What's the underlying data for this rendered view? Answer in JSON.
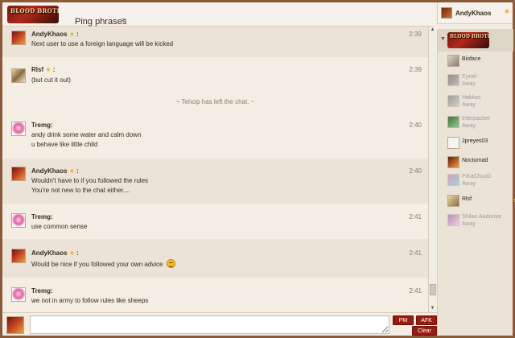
{
  "header": {
    "logo_text": "BLOOD BROTHERS",
    "room_title": "Ping phrases",
    "room_help": "(?)"
  },
  "me": {
    "name": "AndyKhaos"
  },
  "messages": [
    {
      "user": "AndyKhaos",
      "star": "★",
      "colon": ":",
      "lines": [
        "Next user to use a foreign language will be kicked"
      ],
      "time": "2:39"
    },
    {
      "user": "Rlsf",
      "star": "★",
      "colon": ":",
      "lines": [
        "(but cut it out)"
      ],
      "time": "2:39"
    },
    {
      "inline": "~ Tehcip has left the chat. ~"
    },
    {
      "user": "Tremg:",
      "lines": [
        "andy drink some water and calm down",
        "u behave like little child"
      ],
      "time": "2:40"
    },
    {
      "user": "AndyKhaos",
      "star": "★",
      "colon": ":",
      "lines": [
        "Wouldn't have to if you followed the rules",
        "You're not new to the chat either...."
      ],
      "time": "2:40"
    },
    {
      "user": "Tremg:",
      "lines": [
        "use common sense"
      ],
      "time": "2:41"
    },
    {
      "user": "AndyKhaos",
      "star": "★",
      "colon": ":",
      "lines": [
        "Would be nice if you followed your own advice"
      ],
      "time": "2:41"
    },
    {
      "user": "Tremg:",
      "lines": [
        "we not in army to follow rules like sheeps"
      ],
      "time": "2:41"
    }
  ],
  "sidebar": {
    "users": [
      {
        "name": "Bioface",
        "status": ""
      },
      {
        "name": "Cyriel",
        "status": "Away"
      },
      {
        "name": "Hakkas",
        "status": "Away"
      },
      {
        "name": "Interpacket",
        "status": "Away"
      },
      {
        "name": "Jpreyes03",
        "status": ""
      },
      {
        "name": "Nocturnad",
        "status": ""
      },
      {
        "name": "PiKaChuxD",
        "status": "Away"
      },
      {
        "name": "Rlsf",
        "status": ""
      },
      {
        "name": "Shilan Aadomar",
        "status": "Away"
      }
    ]
  },
  "input": {
    "value": ""
  },
  "buttons": {
    "pm": "PM",
    "afk": "AFK",
    "clear": "Clear"
  },
  "icons": {
    "star": "★",
    "arrow_up": "▲",
    "arrow_down": "▼",
    "collapse": "▼"
  },
  "colors": {
    "accent": "#9a1c10",
    "frame": "#8a5a3a",
    "star": "#e8b020"
  }
}
